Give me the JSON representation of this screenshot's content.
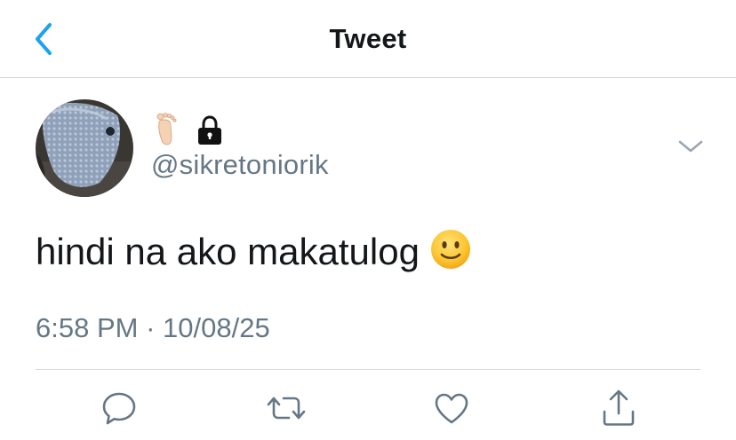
{
  "header": {
    "title": "Tweet",
    "back_icon": "chevron-left-icon"
  },
  "tweet": {
    "display_name_icons": [
      "barefoot-icon",
      "lock-icon"
    ],
    "handle": "@sikretoniorik",
    "text": "hindi na ako makatulog",
    "text_emoji": "slightly-smiling-face-icon",
    "time": "6:58 PM",
    "separator": "·",
    "date": "10/08/25"
  },
  "actions": [
    {
      "icon": "reply-icon"
    },
    {
      "icon": "retweet-icon"
    },
    {
      "icon": "like-icon"
    },
    {
      "icon": "share-icon"
    }
  ],
  "colors": {
    "accent": "#1da1f2",
    "secondary_text": "#657786",
    "primary_text": "#14171a",
    "divider": "#d6dadd"
  }
}
